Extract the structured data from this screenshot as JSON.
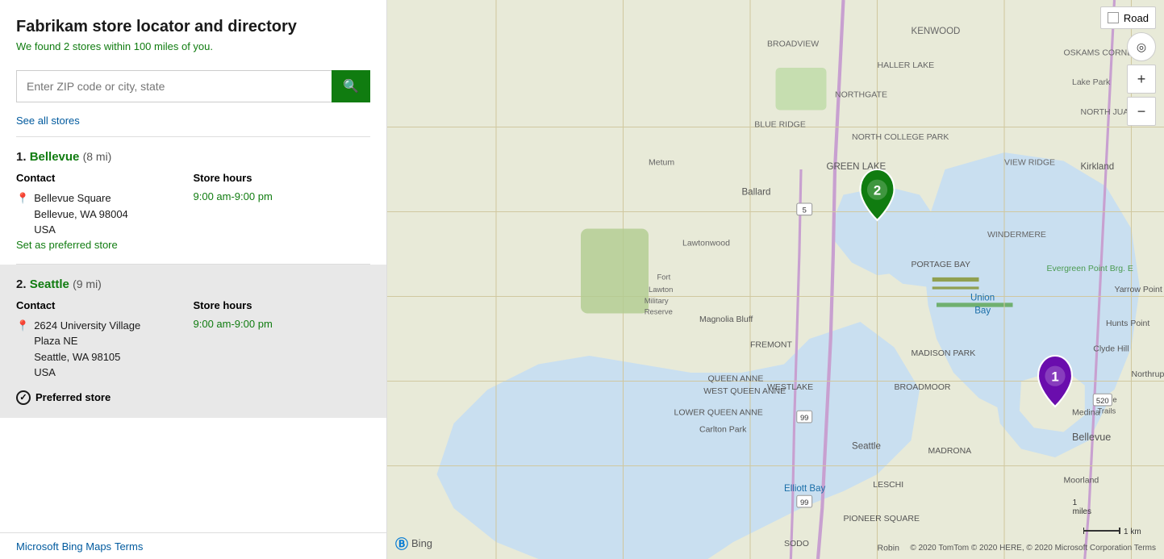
{
  "page": {
    "title": "Fabrikam store locator and directory",
    "subtitle": "We found 2 stores within 100 miles of you.",
    "footer_links": [
      {
        "label": "Microsoft",
        "url": "#"
      },
      {
        "label": "Bing Maps",
        "url": "#"
      },
      {
        "label": "Terms",
        "url": "#"
      }
    ]
  },
  "search": {
    "placeholder": "Enter ZIP code or city, state",
    "button_aria": "Search"
  },
  "see_all": {
    "label": "See all stores"
  },
  "map": {
    "road_toggle_label": "Road",
    "bing_label": "Bing",
    "attribution": "© 2020 TomTom © 2020 HERE, © 2020 Microsoft Corporation  Terms",
    "scale_miles": "1 miles",
    "scale_km": "1 km"
  },
  "stores": [
    {
      "number": "1.",
      "name": "Bellevue",
      "distance": "(8 mi)",
      "contact_header": "Contact",
      "hours_header": "Store hours",
      "address_line1": "Bellevue Square",
      "address_line2": "Bellevue, WA 98004",
      "address_line3": "USA",
      "hours": "9:00 am-9:00 pm",
      "preferred_link": "Set as preferred store",
      "highlighted": false,
      "marker_color": "#6a0dad",
      "marker_number": "1"
    },
    {
      "number": "2.",
      "name": "Seattle",
      "distance": "(9 mi)",
      "contact_header": "Contact",
      "hours_header": "Store hours",
      "address_line1": "2624 University Village",
      "address_line2": "Plaza NE",
      "address_line3": "Seattle, WA 98105",
      "address_line4": "USA",
      "hours": "9:00 am-9:00 pm",
      "preferred_badge": "Preferred store",
      "highlighted": true,
      "marker_color": "#107c10",
      "marker_number": "2"
    }
  ]
}
